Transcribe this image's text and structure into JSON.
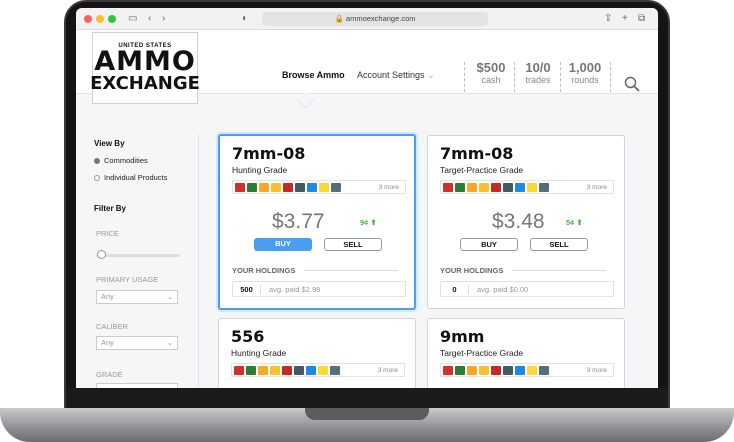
{
  "browser": {
    "url": "ammoexchange.com"
  },
  "logo": {
    "line1": "UNITED STATES",
    "line2": "AMMO",
    "line3": "EXCHANGE"
  },
  "nav": {
    "browse": "Browse Ammo",
    "settings": "Account Settings"
  },
  "stats": [
    {
      "value": "$500",
      "label": "cash"
    },
    {
      "value": "10/0",
      "label": "trades"
    },
    {
      "value": "1,000",
      "label": "rounds"
    }
  ],
  "sidebar": {
    "view_by": "View By",
    "opt_commodities": "Commodities",
    "opt_individual": "Individual Products",
    "filter_by": "Filter By",
    "price": "PRICE",
    "primary_usage": "PRIMARY USAGE",
    "caliber": "CALIBER",
    "grade": "GRADE",
    "any": "Any"
  },
  "brand_more": "3 more",
  "holdings_label": "YOUR HOLDINGS",
  "buy_label": "BUY",
  "sell_label": "SELL",
  "cards": [
    {
      "title": "7mm-08",
      "subtitle": "Hunting Grade",
      "price": "$3.77",
      "change": "9¢ ⬆",
      "qty": "500",
      "paid": "avg. paid $2.98"
    },
    {
      "title": "7mm-08",
      "subtitle": "Target-Practice Grade",
      "price": "$3.48",
      "change": "5¢ ⬆",
      "qty": "0",
      "paid": "avg. paid $0.00"
    },
    {
      "title": "556",
      "subtitle": "Hunting Grade"
    },
    {
      "title": "9mm",
      "subtitle": "Target-Practice Grade"
    }
  ],
  "brand_colors": [
    "#d32f2f",
    "#2e7d32",
    "#f9a825",
    "#fbc02d",
    "#c62828",
    "#455a64",
    "#1e88e5",
    "#fdd835",
    "#546e7a"
  ]
}
